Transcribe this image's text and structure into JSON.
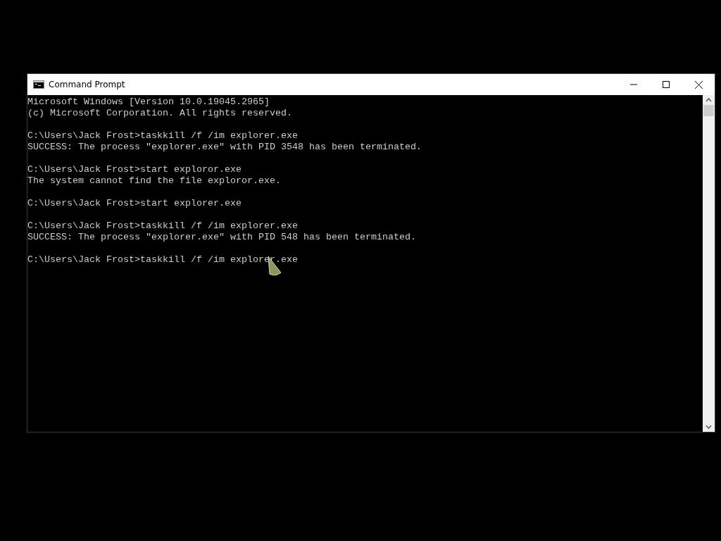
{
  "window": {
    "title": "Command Prompt"
  },
  "console": {
    "blocks": [
      [
        "Microsoft Windows [Version 10.0.19045.2965]",
        "(c) Microsoft Corporation. All rights reserved."
      ],
      [
        "C:\\Users\\Jack Frost>taskkill /f /im explorer.exe",
        "SUCCESS: The process \"explorer.exe\" with PID 3548 has been terminated."
      ],
      [
        "C:\\Users\\Jack Frost>start exploror.exe",
        "The system cannot find the file exploror.exe."
      ],
      [
        "C:\\Users\\Jack Frost>start explorer.exe"
      ],
      [
        "C:\\Users\\Jack Frost>taskkill /f /im explorer.exe",
        "SUCCESS: The process \"explorer.exe\" with PID 548 has been terminated."
      ],
      [
        "C:\\Users\\Jack Frost>taskkill /f /im explorer.exe"
      ]
    ]
  }
}
